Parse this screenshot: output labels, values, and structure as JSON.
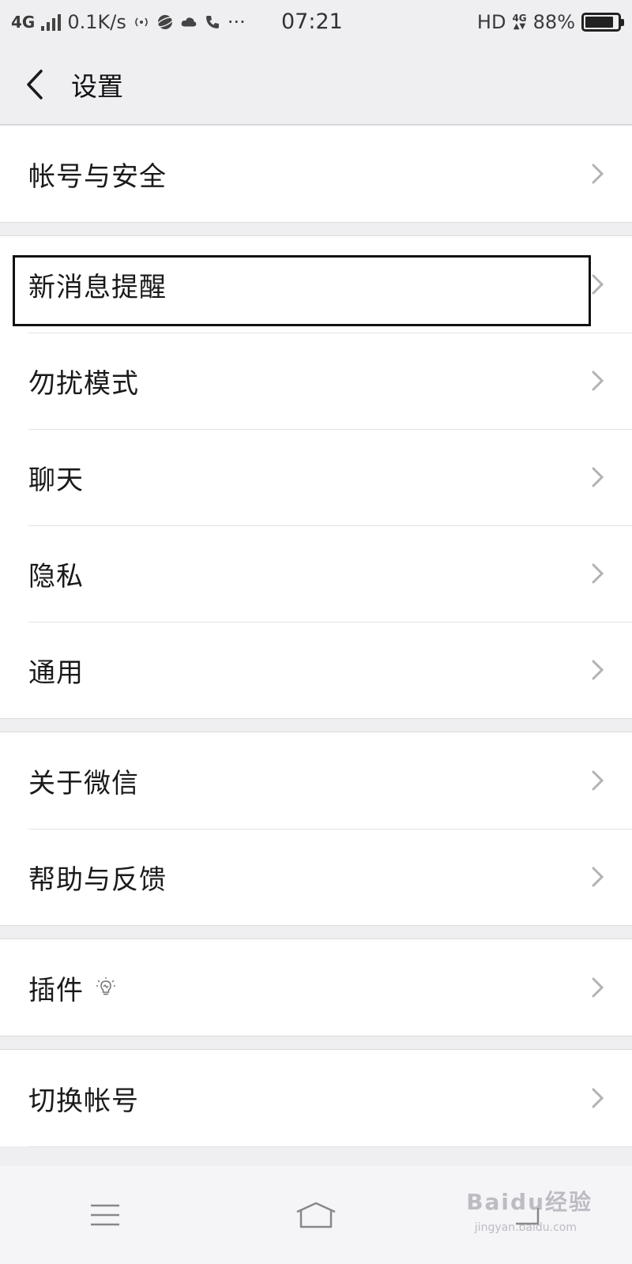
{
  "status_bar": {
    "network": "4G",
    "speed": "0.1K/s",
    "time": "07:21",
    "hd": "HD",
    "net_small": "4G",
    "battery": "88%",
    "battery_level": 0.88
  },
  "nav": {
    "title": "设置"
  },
  "groups": [
    {
      "items": [
        {
          "label": "帐号与安全"
        }
      ]
    },
    {
      "items": [
        {
          "label": "新消息提醒"
        },
        {
          "label": "勿扰模式"
        },
        {
          "label": "聊天"
        },
        {
          "label": "隐私"
        },
        {
          "label": "通用"
        }
      ]
    },
    {
      "items": [
        {
          "label": "关于微信"
        },
        {
          "label": "帮助与反馈"
        }
      ]
    },
    {
      "items": [
        {
          "label": "插件"
        }
      ]
    },
    {
      "items": [
        {
          "label": "切换帐号"
        }
      ]
    }
  ],
  "watermark": {
    "text": "Baidu经验",
    "sub": "jingyan.baidu.com"
  },
  "colors": {
    "background": "#efeef1",
    "row_bg": "#ffffff",
    "chevron": "#b2b2b2"
  }
}
